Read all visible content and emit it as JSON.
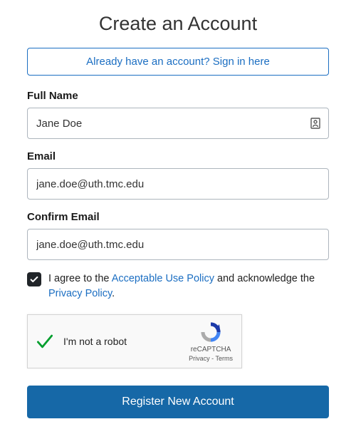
{
  "title": "Create an Account",
  "signin_banner": "Already have an account? Sign in here",
  "fields": {
    "full_name": {
      "label": "Full Name",
      "value": "Jane Doe"
    },
    "email": {
      "label": "Email",
      "value": "jane.doe@uth.tmc.edu"
    },
    "confirm_email": {
      "label": "Confirm Email",
      "value": "jane.doe@uth.tmc.edu"
    }
  },
  "agree": {
    "checked": true,
    "prefix": "I agree to the ",
    "policy1": "Acceptable Use Policy",
    "mid": " and acknowledge the ",
    "policy2": "Privacy Policy",
    "suffix": "."
  },
  "captcha": {
    "label": "I'm not a robot",
    "brand": "reCAPTCHA",
    "privacy": "Privacy",
    "sep": " - ",
    "terms": "Terms",
    "verified": true
  },
  "submit_label": "Register New Account"
}
